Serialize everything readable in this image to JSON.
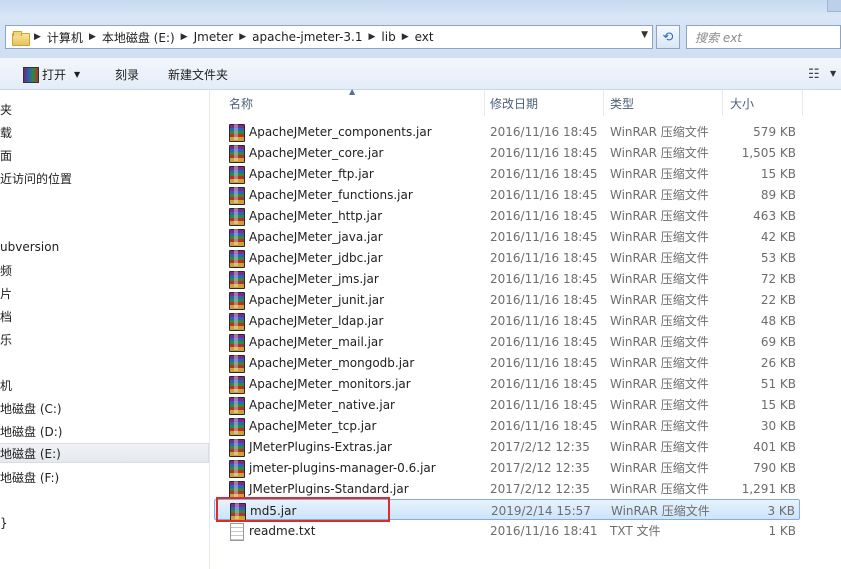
{
  "address_bar": {
    "crumbs": [
      "计算机",
      "本地磁盘 (E:)",
      "Jmeter",
      "apache-jmeter-3.1",
      "lib",
      "ext"
    ],
    "search_placeholder": "搜索 ext"
  },
  "toolbar": {
    "open_label": "打开",
    "burn_label": "刻录",
    "new_folder_label": "新建文件夹"
  },
  "sidebar": {
    "items": [
      "夹",
      "载",
      "面",
      "近访问的位置",
      "ubversion",
      "频",
      "片",
      "档",
      "乐",
      "机",
      "地磁盘 (C:)",
      "地磁盘 (D:)",
      "地磁盘 (E:)",
      "地磁盘 (F:)",
      "}"
    ]
  },
  "columns": {
    "name": "名称",
    "date": "修改日期",
    "type": "类型",
    "size": "大小"
  },
  "files": [
    {
      "name": "ApacheJMeter_components.jar",
      "date": "2016/11/16 18:45",
      "type": "WinRAR 压缩文件",
      "size": "579 KB",
      "icon": "winrar-archive-icon"
    },
    {
      "name": "ApacheJMeter_core.jar",
      "date": "2016/11/16 18:45",
      "type": "WinRAR 压缩文件",
      "size": "1,505 KB",
      "icon": "winrar-archive-icon"
    },
    {
      "name": "ApacheJMeter_ftp.jar",
      "date": "2016/11/16 18:45",
      "type": "WinRAR 压缩文件",
      "size": "15 KB",
      "icon": "winrar-archive-icon"
    },
    {
      "name": "ApacheJMeter_functions.jar",
      "date": "2016/11/16 18:45",
      "type": "WinRAR 压缩文件",
      "size": "89 KB",
      "icon": "winrar-archive-icon"
    },
    {
      "name": "ApacheJMeter_http.jar",
      "date": "2016/11/16 18:45",
      "type": "WinRAR 压缩文件",
      "size": "463 KB",
      "icon": "winrar-archive-icon"
    },
    {
      "name": "ApacheJMeter_java.jar",
      "date": "2016/11/16 18:45",
      "type": "WinRAR 压缩文件",
      "size": "42 KB",
      "icon": "winrar-archive-icon"
    },
    {
      "name": "ApacheJMeter_jdbc.jar",
      "date": "2016/11/16 18:45",
      "type": "WinRAR 压缩文件",
      "size": "53 KB",
      "icon": "winrar-archive-icon"
    },
    {
      "name": "ApacheJMeter_jms.jar",
      "date": "2016/11/16 18:45",
      "type": "WinRAR 压缩文件",
      "size": "72 KB",
      "icon": "winrar-archive-icon"
    },
    {
      "name": "ApacheJMeter_junit.jar",
      "date": "2016/11/16 18:45",
      "type": "WinRAR 压缩文件",
      "size": "22 KB",
      "icon": "winrar-archive-icon"
    },
    {
      "name": "ApacheJMeter_ldap.jar",
      "date": "2016/11/16 18:45",
      "type": "WinRAR 压缩文件",
      "size": "48 KB",
      "icon": "winrar-archive-icon"
    },
    {
      "name": "ApacheJMeter_mail.jar",
      "date": "2016/11/16 18:45",
      "type": "WinRAR 压缩文件",
      "size": "69 KB",
      "icon": "winrar-archive-icon"
    },
    {
      "name": "ApacheJMeter_mongodb.jar",
      "date": "2016/11/16 18:45",
      "type": "WinRAR 压缩文件",
      "size": "26 KB",
      "icon": "winrar-archive-icon"
    },
    {
      "name": "ApacheJMeter_monitors.jar",
      "date": "2016/11/16 18:45",
      "type": "WinRAR 压缩文件",
      "size": "51 KB",
      "icon": "winrar-archive-icon"
    },
    {
      "name": "ApacheJMeter_native.jar",
      "date": "2016/11/16 18:45",
      "type": "WinRAR 压缩文件",
      "size": "15 KB",
      "icon": "winrar-archive-icon"
    },
    {
      "name": "ApacheJMeter_tcp.jar",
      "date": "2016/11/16 18:45",
      "type": "WinRAR 压缩文件",
      "size": "30 KB",
      "icon": "winrar-archive-icon"
    },
    {
      "name": "JMeterPlugins-Extras.jar",
      "date": "2017/2/12 12:35",
      "type": "WinRAR 压缩文件",
      "size": "401 KB",
      "icon": "winrar-archive-icon"
    },
    {
      "name": "jmeter-plugins-manager-0.6.jar",
      "date": "2017/2/12 12:35",
      "type": "WinRAR 压缩文件",
      "size": "790 KB",
      "icon": "winrar-archive-icon"
    },
    {
      "name": "JMeterPlugins-Standard.jar",
      "date": "2017/2/12 12:35",
      "type": "WinRAR 压缩文件",
      "size": "1,291 KB",
      "icon": "winrar-archive-icon"
    },
    {
      "name": "md5.jar",
      "date": "2019/2/14 15:57",
      "type": "WinRAR 压缩文件",
      "size": "3 KB",
      "icon": "winrar-archive-icon",
      "selected": true
    },
    {
      "name": "readme.txt",
      "date": "2016/11/16 18:41",
      "type": "TXT 文件",
      "size": "1 KB",
      "icon": "text-file-icon"
    }
  ],
  "colors": {
    "selection_border": "#84acdd",
    "highlight_box": "#e02b2b"
  }
}
